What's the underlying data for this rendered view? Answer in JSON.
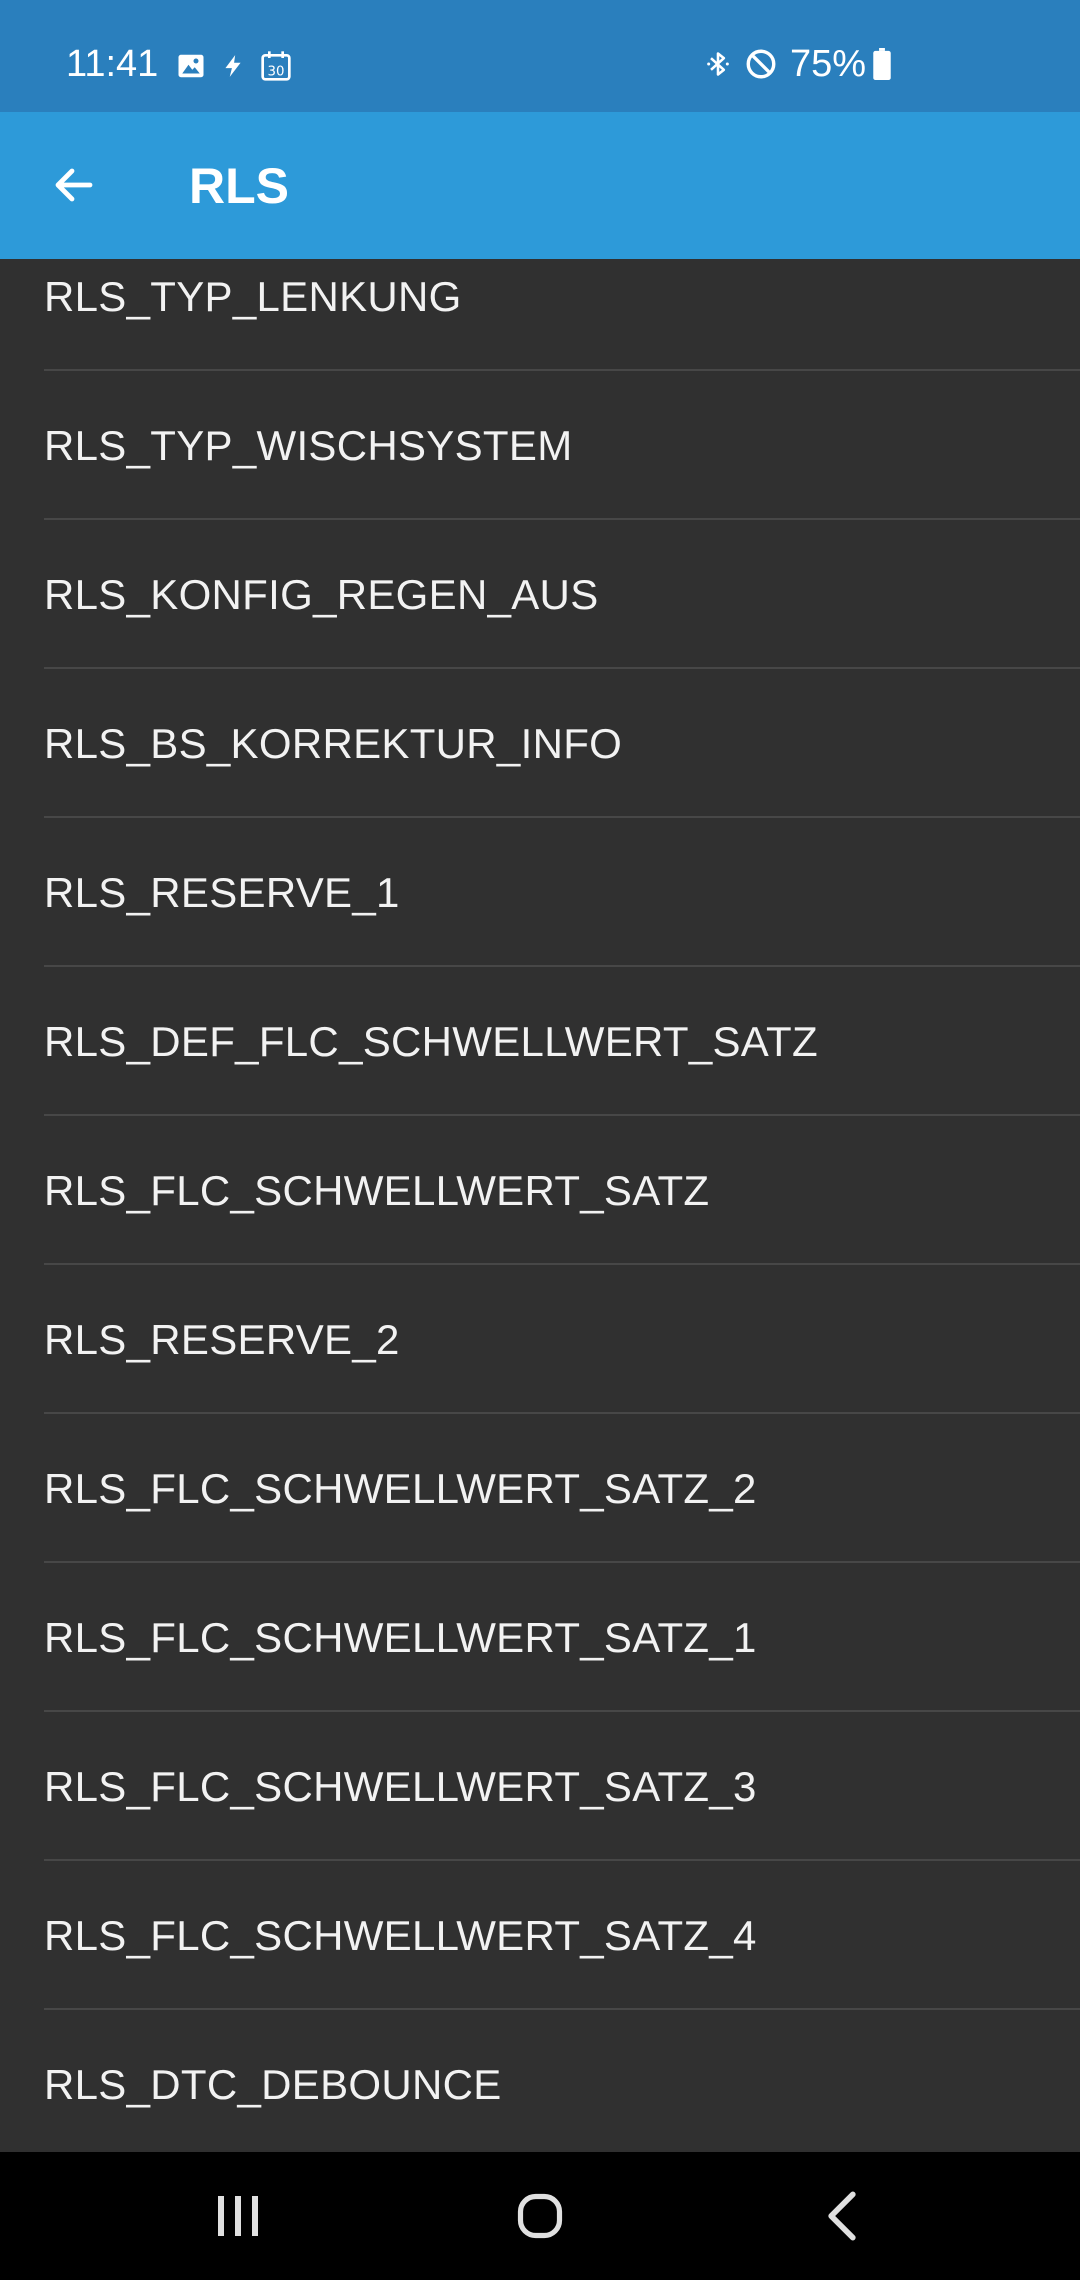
{
  "status_bar": {
    "time": "11:41",
    "battery_percent": "75%",
    "left_icons": [
      "image-icon",
      "bolt-icon",
      "calendar-icon"
    ],
    "right_icons": [
      "bluetooth-icon",
      "do-not-disturb-icon",
      "battery-icon"
    ],
    "calendar_day": "30"
  },
  "app_bar": {
    "title": "RLS",
    "back_icon": "arrow-left-icon"
  },
  "list": {
    "items": [
      "RLS_TYP_LENKUNG",
      "RLS_TYP_WISCHSYSTEM",
      "RLS_KONFIG_REGEN_AUS",
      "RLS_BS_KORREKTUR_INFO",
      "RLS_RESERVE_1",
      "RLS_DEF_FLC_SCHWELLWERT_SATZ",
      "RLS_FLC_SCHWELLWERT_SATZ",
      "RLS_RESERVE_2",
      "RLS_FLC_SCHWELLWERT_SATZ_2",
      "RLS_FLC_SCHWELLWERT_SATZ_1",
      "RLS_FLC_SCHWELLWERT_SATZ_3",
      "RLS_FLC_SCHWELLWERT_SATZ_4",
      "RLS_DTC_DEBOUNCE"
    ]
  },
  "nav_bar": {
    "buttons": [
      "recents-icon",
      "home-icon",
      "back-icon"
    ]
  },
  "colors": {
    "status_bar": "#2a7fbd",
    "app_bar": "#2d9ad9",
    "background": "#303030",
    "divider": "#474747",
    "nav_bar": "#000000"
  }
}
